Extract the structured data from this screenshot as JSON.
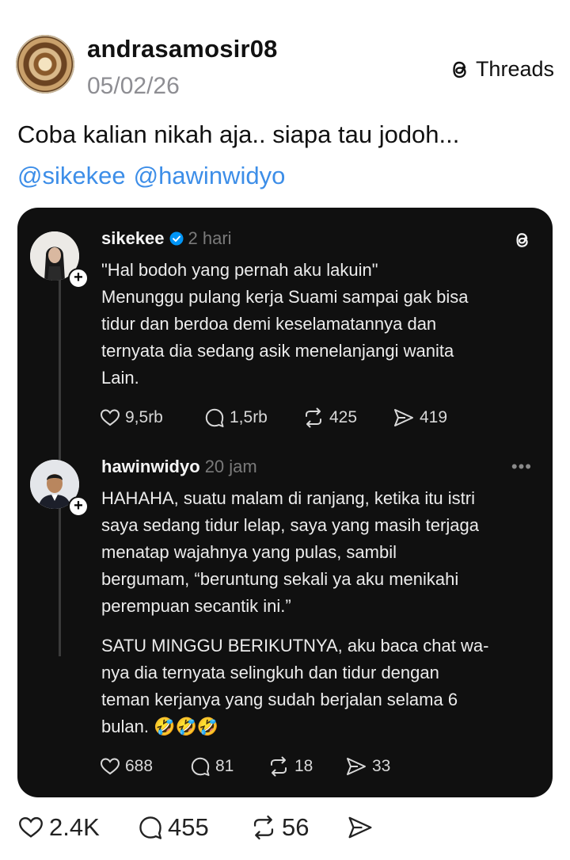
{
  "post": {
    "username": "andrasamosir08",
    "date": "05/02/26",
    "brand": "Threads",
    "text": "Coba kalian nikah aja.. siapa tau jodoh...",
    "mentions": [
      "@sikekee",
      "@hawinwidyo"
    ]
  },
  "embedded": {
    "reply1": {
      "username": "sikekee",
      "time": "2 hari",
      "verified": true,
      "line1": "\"Hal bodoh yang pernah aku lakuin\"",
      "line2": "Menunggu pulang kerja Suami sampai gak bisa",
      "line3": "tidur dan berdoa demi keselamatannya dan",
      "line4": "ternyata dia sedang asik menelanjangi wanita",
      "line5": "Lain.",
      "likes": "9,5rb",
      "comments": "1,5rb",
      "reposts": "425",
      "shares": "419"
    },
    "reply2": {
      "username": "hawinwidyo",
      "time": "20 jam",
      "more": "•••",
      "p1_l1": "HAHAHA, suatu malam di ranjang, ketika itu istri",
      "p1_l2": "saya sedang tidur lelap, saya yang masih terjaga",
      "p1_l3": "menatap wajahnya yang pulas, sambil",
      "p1_l4": "bergumam, “beruntung sekali ya aku menikahi",
      "p1_l5": "perempuan secantik ini.”",
      "p2_l1": "SATU MINGGU BERIKUTNYA, aku baca chat wa-",
      "p2_l2": "nya dia ternyata selingkuh dan tidur dengan",
      "p2_l3": "teman kerjanya yang sudah berjalan selama 6",
      "p2_l4": "bulan. 🤣🤣🤣",
      "likes": "688",
      "comments": "81",
      "reposts": "18",
      "shares": "33"
    }
  },
  "footer": {
    "likes": "2.4K",
    "comments": "455",
    "reposts": "56"
  },
  "colors": {
    "mention": "#3d8ee8",
    "card_bg": "#101010",
    "verified": "#0095f6"
  }
}
